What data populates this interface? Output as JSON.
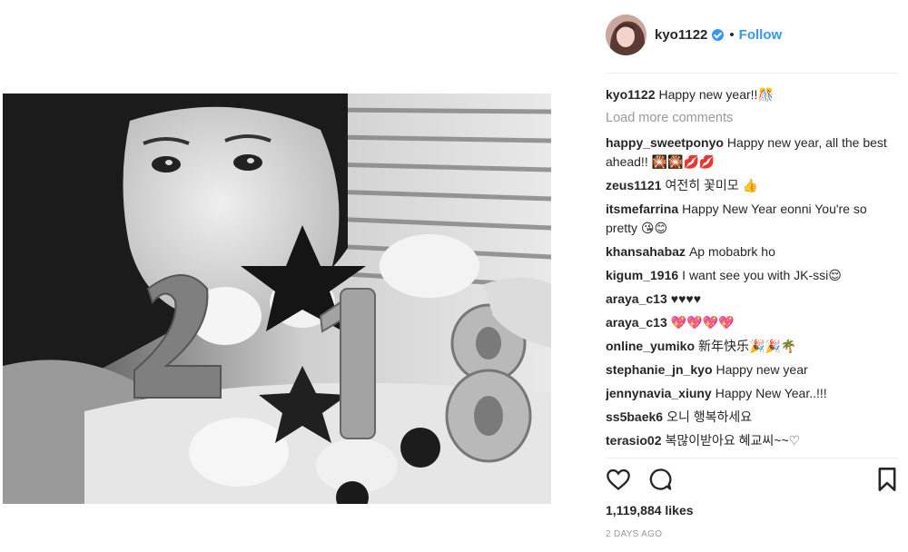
{
  "post": {
    "username": "kyo1122",
    "verified_icon": "verified-badge-icon",
    "separator": "•",
    "follow_label": "Follow",
    "caption": {
      "user": "kyo1122",
      "text": "Happy new year!!🎊"
    },
    "load_more": "Load more comments",
    "comments": [
      {
        "user": "happy_sweetponyo",
        "text": "Happy new year, all the best ahead!! 🎇🎇💋💋"
      },
      {
        "user": "zeus1121",
        "text": "여전히 꽃미모 👍"
      },
      {
        "user": "itsmefarrina",
        "text": "Happy New Year eonni You're so pretty 😘😊"
      },
      {
        "user": "khansahabaz",
        "text": "Ap mobabrk ho"
      },
      {
        "user": "kigum_1916",
        "text": "I want see you with JK-ssi😌"
      },
      {
        "user": "araya_c13",
        "text": "♥♥♥♥"
      },
      {
        "user": "araya_c13",
        "text": "💖💖💖💖"
      },
      {
        "user": "online_yumiko",
        "text": "新年快乐🎉🎉🌴"
      },
      {
        "user": "stephanie_jn_kyo",
        "text": "Happy new year"
      },
      {
        "user": "jennynavia_xiuny",
        "text": "Happy New Year..!!!"
      },
      {
        "user": "ss5baek6",
        "text": "오니 행복하세요"
      },
      {
        "user": "terasio02",
        "text": "복많이받아요 혜교씨~~♡"
      }
    ],
    "likes": "1,119,884 likes",
    "time": "2 DAYS AGO",
    "icons": {
      "like": "heart-icon",
      "comment": "comment-icon",
      "save": "bookmark-icon"
    },
    "colors": {
      "link_blue": "#3897f0",
      "muted_gray": "#999999",
      "text": "#262626",
      "divider": "#efefef"
    }
  }
}
